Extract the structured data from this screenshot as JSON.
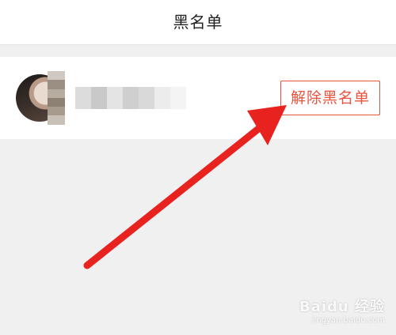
{
  "header": {
    "title": "黑名单"
  },
  "blacklist": {
    "items": [
      {
        "avatar_icon": "user-avatar-photo",
        "name_redacted": true,
        "unblock_label": "解除黑名单"
      }
    ]
  },
  "annotation": {
    "arrow_color": "#e8231f"
  },
  "watermark": {
    "brand": "Baidu 经验",
    "url": "jingyan.baidu.com"
  },
  "colors": {
    "accent": "#e8533f",
    "background": "#f0f0f0",
    "card": "#ffffff"
  }
}
